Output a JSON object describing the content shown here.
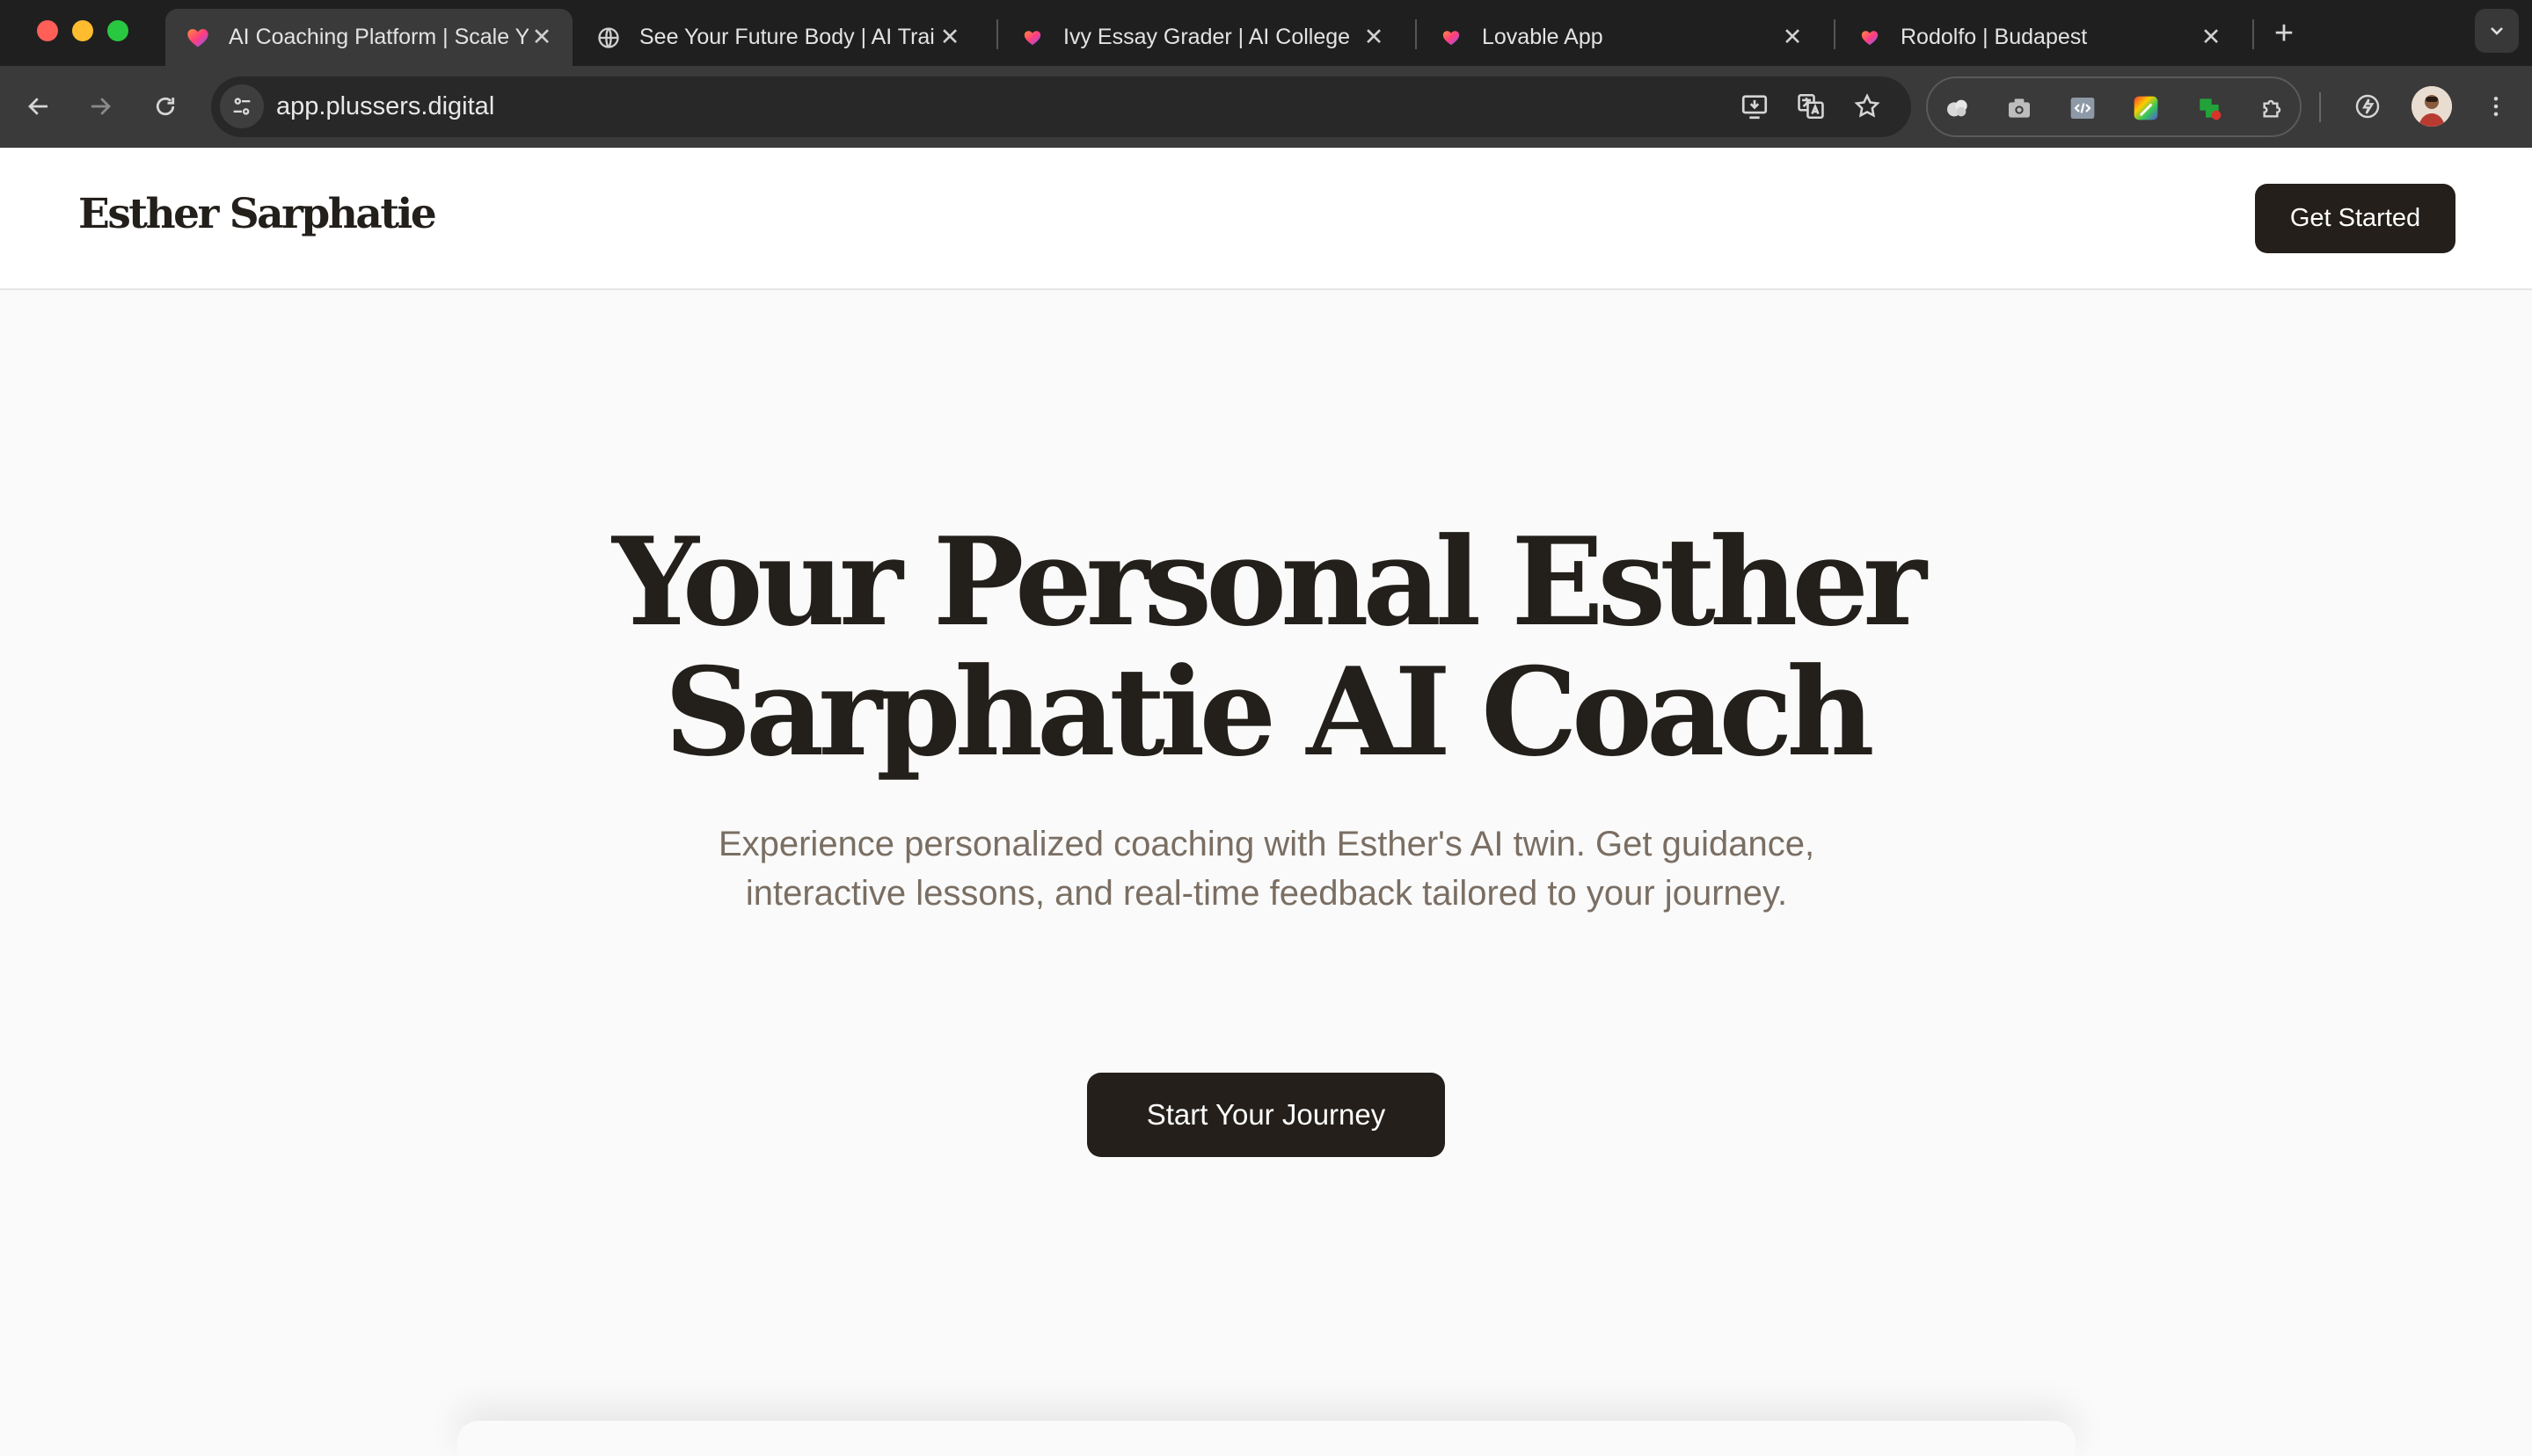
{
  "browser": {
    "tabs": [
      {
        "title": "AI Coaching Platform | Scale Y",
        "active": true,
        "icon": "lovable-heart-icon"
      },
      {
        "title": "See Your Future Body | AI Trai",
        "active": false,
        "icon": "globe-icon"
      },
      {
        "title": "Ivy Essay Grader | AI College",
        "active": false,
        "icon": "lovable-heart-icon"
      },
      {
        "title": "Lovable App",
        "active": false,
        "icon": "lovable-heart-icon"
      },
      {
        "title": "Rodolfo | Budapest",
        "active": false,
        "icon": "lovable-heart-icon"
      }
    ],
    "url": "app.plussers.digital"
  },
  "site": {
    "brand": "Esther Sarphatie",
    "header_button": "Get Started"
  },
  "hero": {
    "title_line1": "Your Personal Esther",
    "title_line2": "Sarphatie AI Coach",
    "subtitle": "Experience personalized coaching with Esther's AI twin. Get guidance, interactive lessons, and real-time feedback tailored to your journey.",
    "cta": "Start Your Journey"
  },
  "colors": {
    "primary_dark": "#241f1a",
    "heading": "#231f1b",
    "subtitle": "#7a6e63",
    "page_background": "#fafafa"
  }
}
